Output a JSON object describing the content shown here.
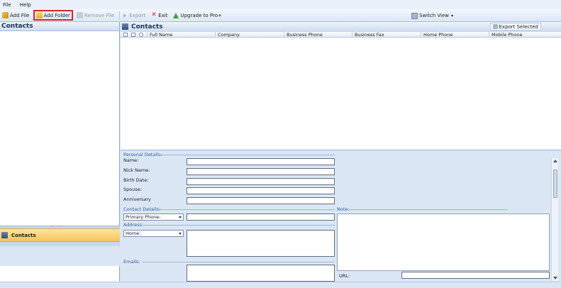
{
  "menu": {
    "file": "File",
    "help": "Help"
  },
  "toolbar": {
    "add_file": "Add File",
    "add_folder": "Add Folder",
    "remove_file": "Remove File",
    "export": "Export",
    "exit": "Exit",
    "upgrade": "Upgrade to Pro+",
    "switch_view": "Switch View"
  },
  "left_pane": {
    "title": "Contacts",
    "nav_contacts": "Contacts"
  },
  "right_pane": {
    "title": "Contacts",
    "export_selected": "Export Selected",
    "columns": [
      "Full Name",
      "Company",
      "Business Phone",
      "Business Fax",
      "Home Phone",
      "Mobile Phone"
    ]
  },
  "details": {
    "personal_section": "Personal Details:",
    "name": "Name:",
    "nick_name": "Nick Name:",
    "birth_date": "Birth Date:",
    "spouse": "Spouse:",
    "anniversary": "Anniversary",
    "contact_section": "Contact Details:",
    "phone_type": "Primary Phone:",
    "address_section": "Address:",
    "address_type": "Home:",
    "emails_section": "Emails:",
    "note_section": "Note:",
    "url": "URL:"
  },
  "colors": {
    "accent": "#dbe6f4",
    "highlight": "#d8232a",
    "selected_nav": "#f6c35a"
  }
}
